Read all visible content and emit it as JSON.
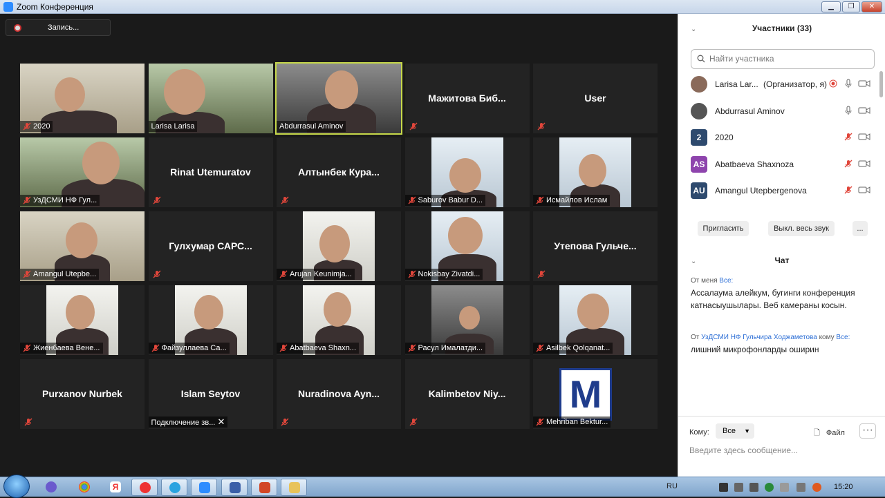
{
  "window": {
    "title": "Zoom Конференция",
    "min": "▁",
    "max": "❐",
    "close": "✕"
  },
  "recording": {
    "label": "Запись..."
  },
  "tiles": [
    {
      "name": "2020",
      "kind": "video"
    },
    {
      "name": "Larisa Larisa",
      "kind": "video"
    },
    {
      "name": "Abdurrasul Aminov",
      "kind": "video"
    },
    {
      "name": "Мажитова Биб...",
      "kind": "text"
    },
    {
      "name": "User",
      "kind": "text"
    },
    {
      "name": "УзДСМИ НФ Гул...",
      "kind": "video"
    },
    {
      "name": "Rinat Utemuratov",
      "kind": "text"
    },
    {
      "name": "Алтынбек Кура...",
      "kind": "text"
    },
    {
      "name": "Saburov Babur D...",
      "kind": "video"
    },
    {
      "name": "Исмайлов Ислам",
      "kind": "video"
    },
    {
      "name": "Amangul Utepbe...",
      "kind": "video"
    },
    {
      "name": "Гулхумар САРС...",
      "kind": "text"
    },
    {
      "name": "Arujan Keunimja...",
      "kind": "video"
    },
    {
      "name": "Nokisbay Zivatdi...",
      "kind": "video"
    },
    {
      "name": "Утепова Гульче...",
      "kind": "text"
    },
    {
      "name": "Жиенбаева Вене...",
      "kind": "video"
    },
    {
      "name": "Файзуллаева Са...",
      "kind": "video"
    },
    {
      "name": "Abatbaeva Shaxn...",
      "kind": "video"
    },
    {
      "name": "Расул Ималатди...",
      "kind": "video"
    },
    {
      "name": "Asilbek Qolqanat...",
      "kind": "video"
    },
    {
      "name": "Purxanov Nurbek",
      "kind": "text"
    },
    {
      "name": "Islam Seytov",
      "kind": "text"
    },
    {
      "name": "Nuradinova Ayn...",
      "kind": "text"
    },
    {
      "name": "Kalimbetov Niy...",
      "kind": "text"
    },
    {
      "name": "Mehriban Bektur...",
      "kind": "logo"
    }
  ],
  "connecting_label": "Подключение зв...",
  "logo_letter": "M",
  "participants": {
    "title": "Участники (33)",
    "search_placeholder": "Найти участника",
    "rows": [
      {
        "avatar": "",
        "name": "Larisa Lar...",
        "role": "(Организатор, я)"
      },
      {
        "avatar": "",
        "name": "Abdurrasul Aminov",
        "role": ""
      },
      {
        "avatar": "2",
        "name": "2020",
        "role": ""
      },
      {
        "avatar": "AS",
        "name": "Abatbaeva Shaxnoza",
        "role": ""
      },
      {
        "avatar": "AU",
        "name": "Amangul Utepbergenova",
        "role": ""
      }
    ],
    "invite": "Пригласить",
    "mute_all": "Выкл. весь звук",
    "more": "..."
  },
  "chat": {
    "title": "Чат",
    "msg1_from": "От меня",
    "msg1_to": "Все:",
    "msg1_text": "Ассалаума алейкум, бугинги конференция катнасыушылары. Веб камераны косын.",
    "msg2_from_prefix": "От",
    "msg2_from": "УзДСМИ НФ Гульчира Ходжаметова",
    "msg2_mid": "кому",
    "msg2_to": "Все:",
    "msg2_text": "лишний микрофонларды оширин",
    "to_label": "Кому:",
    "to_value": "Все",
    "file_label": "Файл",
    "input_placeholder": "Введите здесь сообщение..."
  },
  "taskbar": {
    "lang": "RU",
    "time": "15:20"
  },
  "colors": {
    "accent": "#2d8cff",
    "active_speaker": "#c7d94a",
    "muted": "#e0463b",
    "avatar_blue": "#2e4a6e",
    "avatar_purple": "#8e44ad"
  }
}
